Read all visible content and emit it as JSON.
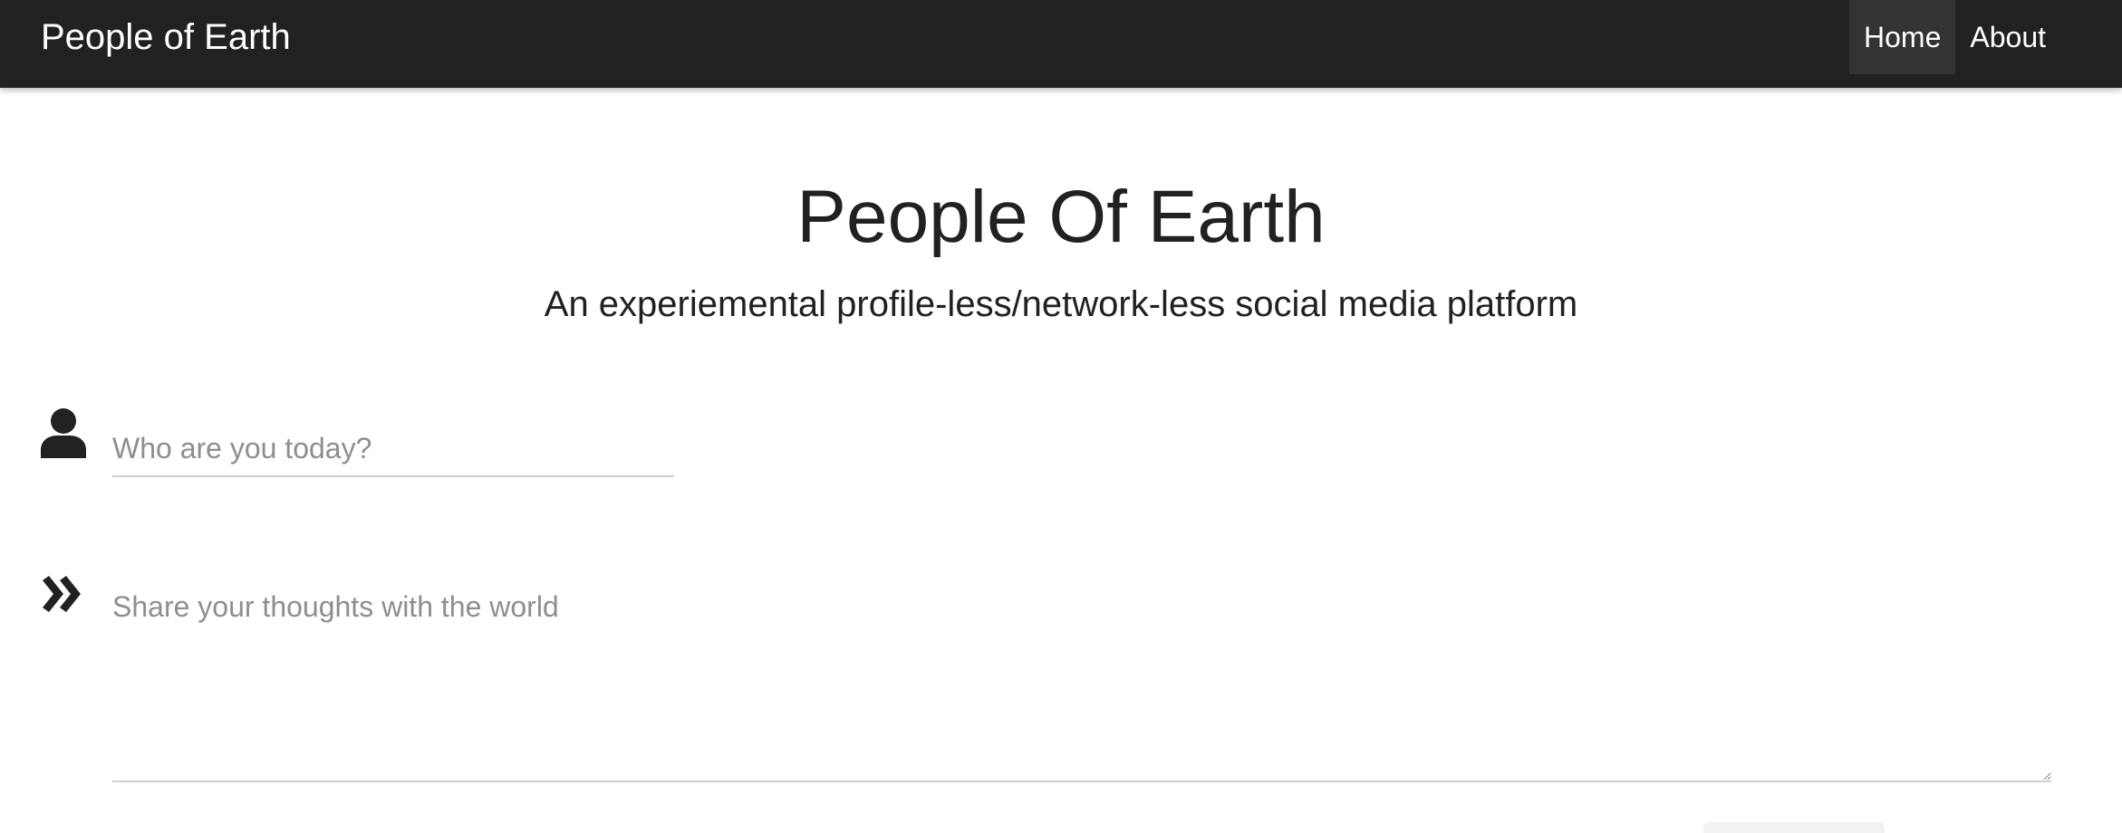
{
  "navbar": {
    "brand": "People of Earth",
    "links": [
      {
        "label": "Home",
        "active": true
      },
      {
        "label": "About",
        "active": false
      }
    ]
  },
  "hero": {
    "title": "People Of Earth",
    "subtitle": "An experiemental profile-less/network-less social media platform"
  },
  "form": {
    "name": {
      "icon": "user-icon",
      "placeholder": "Who are you today?",
      "value": ""
    },
    "thoughts": {
      "icon": "double-chevron-right-icon",
      "placeholder": "Share your thoughts with the world",
      "value": ""
    }
  },
  "colors": {
    "navbar_bg": "#212121",
    "active_link_bg": "#333333",
    "text": "#212121",
    "placeholder": "#8e8e8e",
    "field_border": "#cfcfcf"
  }
}
